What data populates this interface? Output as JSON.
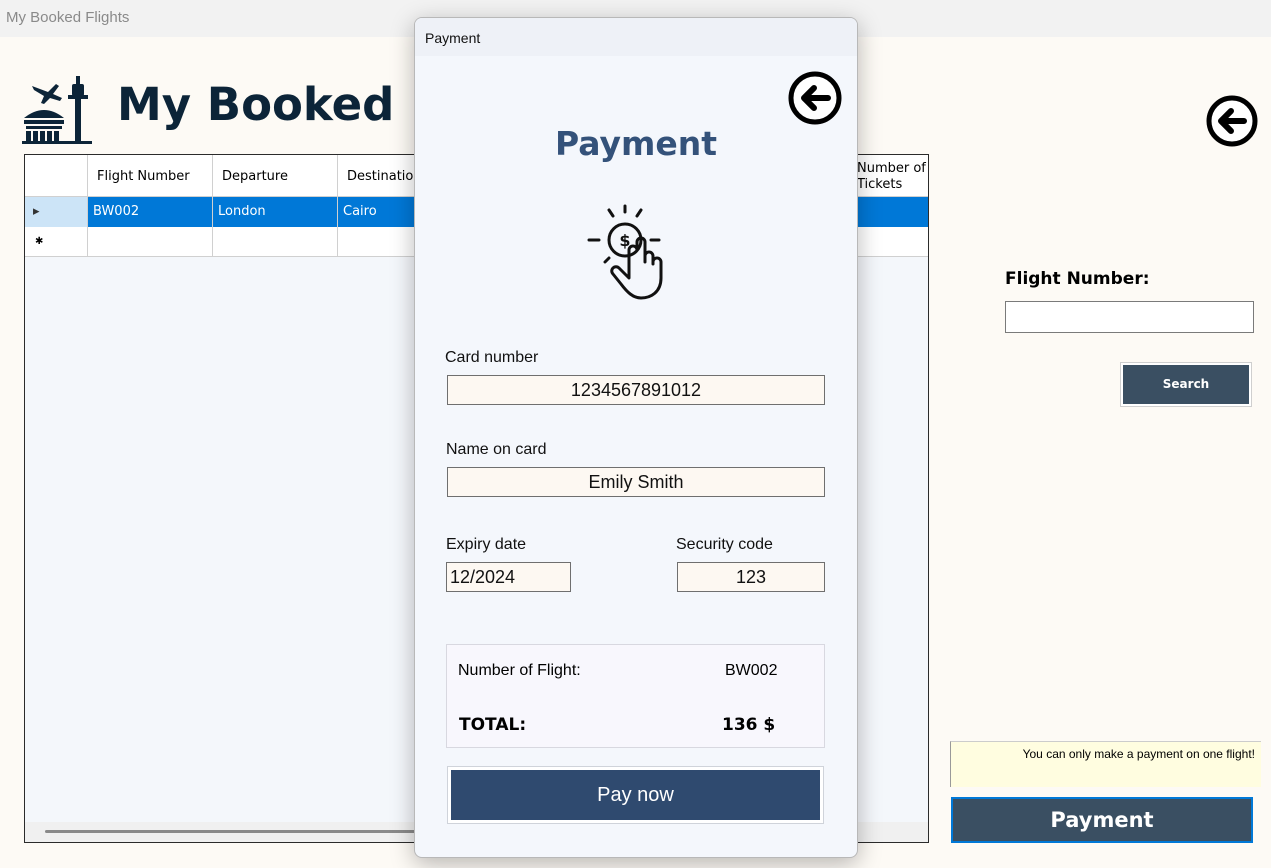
{
  "main_window": {
    "title": "My Booked Flights"
  },
  "header": {
    "title": "My Booked Flights"
  },
  "grid": {
    "columns": [
      "Flight Number",
      "Departure",
      "Destination",
      "Number of Tickets"
    ],
    "rows": [
      {
        "flight_number": "BW002",
        "departure": "London",
        "destination": "Cairo"
      }
    ]
  },
  "search": {
    "label": "Flight Number:",
    "value": "",
    "button": "Search"
  },
  "note": "You can only make a payment on one flight!",
  "payment_button": "Payment",
  "dialog": {
    "title": "Payment",
    "heading": "Payment",
    "card_number": {
      "label": "Card number",
      "value": "1234567891012"
    },
    "name_on_card": {
      "label": "Name on card",
      "value": "Emily Smith"
    },
    "expiry": {
      "label": "Expiry date",
      "value": "12/2024"
    },
    "security": {
      "label": "Security code",
      "value": "123"
    },
    "summary": {
      "flight_label": "Number of Flight:",
      "flight_value": "BW002",
      "total_label": "TOTAL:",
      "total_value": "136 $"
    },
    "pay_button": "Pay now"
  },
  "colors": {
    "accent": "#0078d7",
    "dialog_heading": "#34527a",
    "button_dark": "#3a4f62",
    "pay_now": "#2f4a6f"
  }
}
